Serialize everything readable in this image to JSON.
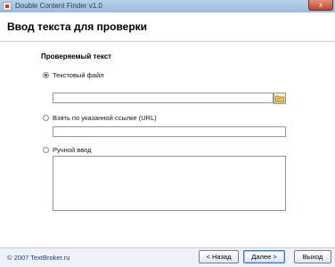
{
  "window": {
    "title": "Double Content Finder v1.0",
    "close_label": "x"
  },
  "page": {
    "title": "Ввод текста для проверки"
  },
  "group": {
    "label": "Проверяемый текст"
  },
  "options": {
    "file": {
      "label": "Текстовый файл",
      "checked": true,
      "value": ""
    },
    "url": {
      "label": "Взять по указанной ссылке (URL)",
      "checked": false,
      "value": ""
    },
    "manual": {
      "label": "Ручной ввод",
      "checked": false,
      "value": ""
    }
  },
  "footer": {
    "copyright": "© 2007 TextBroker.ru",
    "back_label": "< Назад",
    "next_label": "Далее >",
    "exit_label": "Выход"
  },
  "colors": {
    "title_bar": "#9cbbe0",
    "accent": "#3b73c5",
    "link": "#1d3a8a"
  },
  "icons": {
    "browse": "folder-icon",
    "app": "app-icon"
  }
}
